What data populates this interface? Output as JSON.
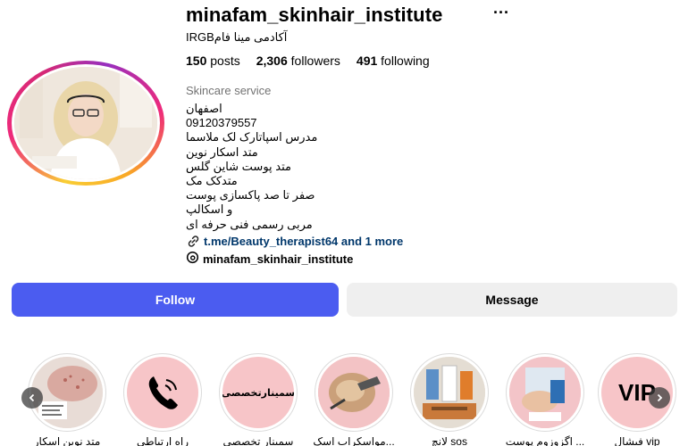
{
  "profile": {
    "username": "minafam_skinhair_institute",
    "more_icon": "more-dots-icon",
    "full_name": "آکادمی مینا فامIRGB",
    "stats": {
      "posts_count": "150",
      "posts_label": "posts",
      "followers_count": "2,306",
      "followers_label": "followers",
      "following_count": "491",
      "following_label": "following"
    },
    "category": "Skincare service",
    "bio_lines": [
      "اصفهان",
      "09120379557",
      "مدرس اسپاتارک لک ملاسما",
      "متد اسکار نوین",
      "متد پوست شاین گلس",
      "متدکک مک",
      "صفر تا صد پاکسازی پوست",
      "و اسکالپ",
      "مربی رسمی فنی حرفه ای"
    ],
    "link_text": "t.me/Beauty_therapist64 and 1 more",
    "threads_handle": "minafam_skinhair_institute"
  },
  "actions": {
    "follow_label": "Follow",
    "message_label": "Message"
  },
  "highlights": [
    {
      "label": "متد نوین اسکار",
      "icon": "scar-photo"
    },
    {
      "label": "راه ارتباطی",
      "icon": "phone-icon"
    },
    {
      "label": "سمینار تخصصی",
      "icon": "seminar-text",
      "inner_text": "سمینارتخصصی"
    },
    {
      "label": "مواسکراب اسک...",
      "icon": "scalp-photo"
    },
    {
      "label": "لانچ sos",
      "icon": "products-photo"
    },
    {
      "label": "اگزوزوم پوست ...",
      "icon": "treatment-photo"
    },
    {
      "label": "فیشال vip",
      "icon": "vip-text",
      "inner_text": "VIP"
    }
  ],
  "colors": {
    "follow_button": "#4b5cf0",
    "message_button": "#efefef",
    "link": "#00376b",
    "highlight_pink": "#f7c5c8"
  }
}
